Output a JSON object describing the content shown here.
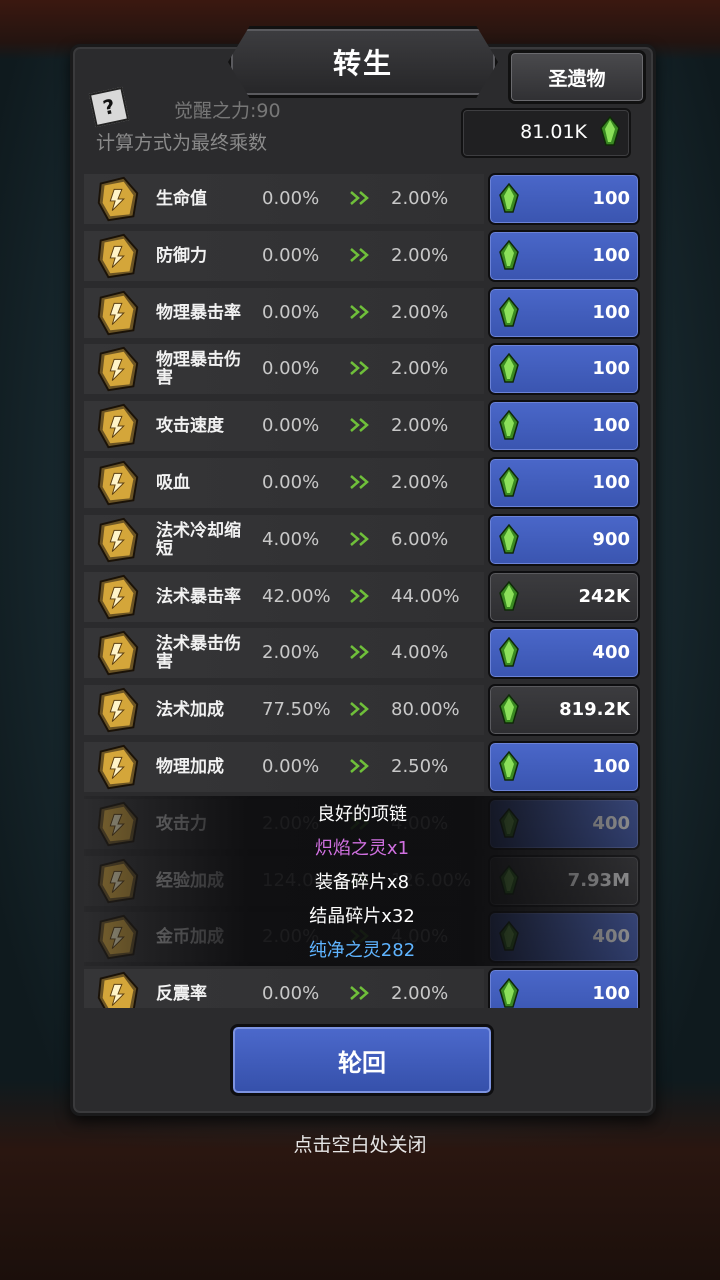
{
  "title": "转生",
  "relic_button": "圣遗物",
  "awaken_power": "觉醒之力:90",
  "formula_note": "计算方式为最终乘数",
  "currency_amount": "81.01K",
  "stats": [
    {
      "name": "生命值",
      "current": "0.00%",
      "next": "2.00%",
      "cost": "100",
      "affordable": true
    },
    {
      "name": "防御力",
      "current": "0.00%",
      "next": "2.00%",
      "cost": "100",
      "affordable": true
    },
    {
      "name": "物理暴击率",
      "current": "0.00%",
      "next": "2.00%",
      "cost": "100",
      "affordable": true
    },
    {
      "name": "物理暴击伤害",
      "current": "0.00%",
      "next": "2.00%",
      "cost": "100",
      "affordable": true
    },
    {
      "name": "攻击速度",
      "current": "0.00%",
      "next": "2.00%",
      "cost": "100",
      "affordable": true
    },
    {
      "name": "吸血",
      "current": "0.00%",
      "next": "2.00%",
      "cost": "100",
      "affordable": true
    },
    {
      "name": "法术冷却缩短",
      "current": "4.00%",
      "next": "6.00%",
      "cost": "900",
      "affordable": true
    },
    {
      "name": "法术暴击率",
      "current": "42.00%",
      "next": "44.00%",
      "cost": "242K",
      "affordable": false
    },
    {
      "name": "法术暴击伤害",
      "current": "2.00%",
      "next": "4.00%",
      "cost": "400",
      "affordable": true
    },
    {
      "name": "法术加成",
      "current": "77.50%",
      "next": "80.00%",
      "cost": "819.2K",
      "affordable": false
    },
    {
      "name": "物理加成",
      "current": "0.00%",
      "next": "2.50%",
      "cost": "100",
      "affordable": true
    },
    {
      "name": "攻击力",
      "current": "2.00%",
      "next": "4.00%",
      "cost": "400",
      "affordable": true
    },
    {
      "name": "经验加成",
      "current": "124.00%",
      "next": "126.00%",
      "cost": "7.93M",
      "affordable": false
    },
    {
      "name": "金币加成",
      "current": "2.00%",
      "next": "4.00%",
      "cost": "400",
      "affordable": true
    },
    {
      "name": "反震率",
      "current": "0.00%",
      "next": "2.00%",
      "cost": "100",
      "affordable": true
    }
  ],
  "loot_popup": [
    {
      "text": "良好的项链",
      "color": "#ffffff"
    },
    {
      "text": "炽焰之灵x1",
      "color": "#d070e0"
    },
    {
      "text": "装备碎片x8",
      "color": "#ffffff"
    },
    {
      "text": "结晶碎片x32",
      "color": "#ffffff"
    },
    {
      "text": "纯净之灵282",
      "color": "#5fb4ff"
    }
  ],
  "reincarnate_button": "轮回",
  "close_hint": "点击空白处关闭",
  "colors": {
    "panel": "#2b2b2d",
    "cost_button_blue": "#4361c4",
    "crystal_green": "#5ec43a"
  }
}
